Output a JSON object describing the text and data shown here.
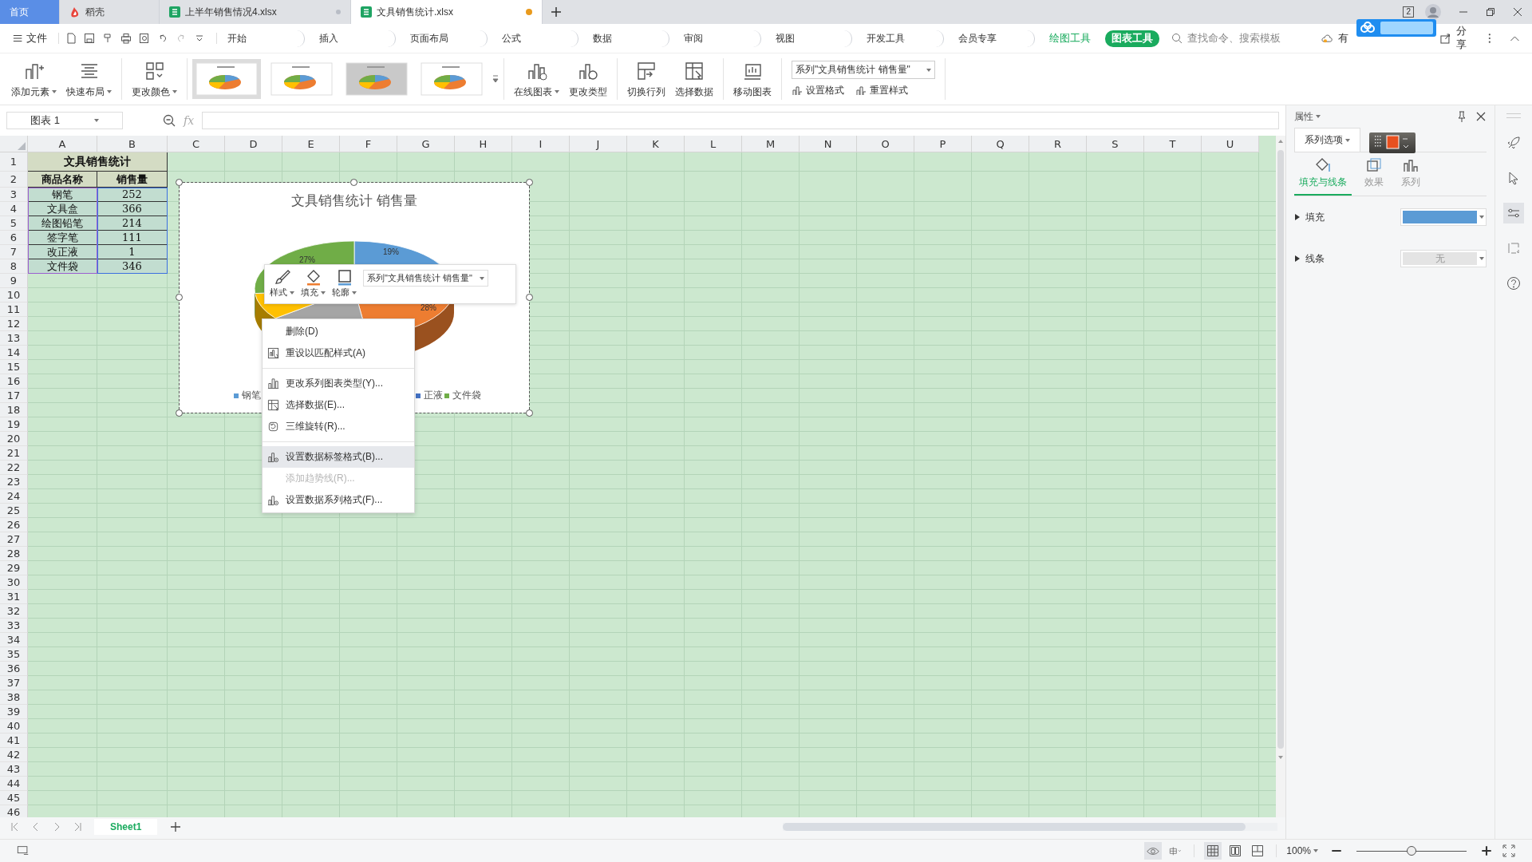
{
  "tabs": [
    {
      "label": "首页",
      "kind": "home",
      "selected": false
    },
    {
      "label": "稻壳",
      "kind": "docer",
      "selected": false
    },
    {
      "label": "上半年销售情况4.xlsx",
      "kind": "sheet",
      "selected": false,
      "modified": false
    },
    {
      "label": "文具销售统计.xlsx",
      "kind": "sheet",
      "selected": true,
      "modified": true
    }
  ],
  "title_bar": {
    "window_count": "2"
  },
  "menu": {
    "file": "文件",
    "items": [
      {
        "label": "开始",
        "kind": "tab",
        "selected": false
      },
      {
        "label": "插入",
        "kind": "tab",
        "selected": false
      },
      {
        "label": "页面布局",
        "kind": "tab",
        "selected": false
      },
      {
        "label": "公式",
        "kind": "tab",
        "selected": false
      },
      {
        "label": "数据",
        "kind": "tab",
        "selected": false
      },
      {
        "label": "审阅",
        "kind": "tab",
        "selected": false
      },
      {
        "label": "视图",
        "kind": "tab",
        "selected": false
      },
      {
        "label": "开发工具",
        "kind": "tab",
        "selected": false
      },
      {
        "label": "会员专享",
        "kind": "tab",
        "selected": false
      },
      {
        "label": "绘图工具",
        "kind": "context",
        "selected": false
      },
      {
        "label": "图表工具",
        "kind": "context",
        "selected": true
      }
    ],
    "search": {
      "placeholder": "查找命令、搜索模板"
    },
    "cloud_label": "有",
    "share": "分享"
  },
  "ribbon": {
    "left_buttons": [
      {
        "label": "添加元素",
        "dropdown": true
      },
      {
        "label": "快速布局",
        "dropdown": true
      },
      {
        "label": "更改颜色",
        "dropdown": true
      }
    ],
    "styles": [
      {
        "selected": true
      },
      {
        "selected": false
      },
      {
        "selected": false
      },
      {
        "selected": false
      }
    ],
    "right_buttons": [
      {
        "label": "在线图表",
        "dropdown": true
      },
      {
        "label": "更改类型",
        "dropdown": false
      },
      {
        "label": "切换行列",
        "dropdown": false
      },
      {
        "label": "选择数据",
        "dropdown": false
      },
      {
        "label": "移动图表",
        "dropdown": false
      }
    ],
    "series_select": "系列\"文具销售统计 销售量\"",
    "small_buttons": [
      "设置格式",
      "重置样式"
    ]
  },
  "formula_bar": {
    "name_box": "图表 1",
    "fx": "fx"
  },
  "sheet": {
    "columns": [
      "A",
      "B",
      "C",
      "D",
      "E",
      "F",
      "G",
      "H",
      "I",
      "J",
      "K",
      "L",
      "M",
      "N",
      "O",
      "P",
      "Q",
      "R",
      "S",
      "T",
      "U"
    ],
    "rows": [
      "1",
      "2",
      "3",
      "4",
      "5",
      "6",
      "7",
      "8",
      "9",
      "10",
      "11",
      "12",
      "13",
      "14",
      "15",
      "16",
      "17",
      "18",
      "19",
      "20",
      "21",
      "22",
      "23",
      "24",
      "25",
      "26",
      "27",
      "28",
      "29",
      "30",
      "31",
      "32",
      "33",
      "34",
      "35",
      "36",
      "37",
      "38",
      "39",
      "40",
      "41",
      "42",
      "43",
      "44",
      "45",
      "46"
    ],
    "table": {
      "title": "文具销售统计",
      "header": [
        "商品名称",
        "销售量"
      ],
      "rows": [
        [
          "钢笔",
          "252"
        ],
        [
          "文具盒",
          "366"
        ],
        [
          "绘图铅笔",
          "214"
        ],
        [
          "签字笔",
          "111"
        ],
        [
          "改正液",
          "1"
        ],
        [
          "文件袋",
          "346"
        ]
      ]
    },
    "tabs": [
      {
        "label": "Sheet1",
        "selected": true
      }
    ]
  },
  "chart": {
    "title": "文具销售统计 销售量",
    "slices": [
      {
        "color": "#5b9bd5"
      },
      {
        "color": "#ed7d31"
      },
      {
        "color": "#a5a5a5"
      },
      {
        "color": "#ffc000"
      },
      {
        "color": "#70ad47"
      }
    ],
    "data_labels": [
      "19%",
      "28%",
      "27%"
    ],
    "legend": [
      {
        "label": "钢笔",
        "color": "#5b9bd5"
      },
      {
        "label": "正液",
        "color": "#4472c4"
      },
      {
        "label": "文件袋",
        "color": "#70ad47"
      }
    ]
  },
  "mini_toolbar": {
    "buttons": [
      {
        "label": "样式",
        "kind": "brush"
      },
      {
        "label": "填充",
        "kind": "fill"
      },
      {
        "label": "轮廓",
        "kind": "outline"
      }
    ],
    "series_select": "系列\"文具销售统计 销售量\""
  },
  "context_menu": [
    {
      "kind": "plain",
      "label": "删除(D)",
      "disabled": false,
      "selected": false
    },
    {
      "kind": "reset",
      "label": "重设以匹配样式(A)",
      "disabled": false,
      "selected": false
    },
    {
      "kind": "separator"
    },
    {
      "kind": "chart",
      "label": "更改系列图表类型(Y)...",
      "disabled": false,
      "selected": false
    },
    {
      "kind": "data",
      "label": "选择数据(E)...",
      "disabled": false,
      "selected": false
    },
    {
      "kind": "rotate",
      "label": "三维旋转(R)...",
      "disabled": false,
      "selected": false
    },
    {
      "kind": "separator"
    },
    {
      "kind": "format",
      "label": "设置数据标签格式(B)...",
      "disabled": false,
      "selected": true
    },
    {
      "kind": "plain",
      "label": "添加趋势线(R)...",
      "disabled": true,
      "selected": false
    },
    {
      "kind": "format",
      "label": "设置数据系列格式(F)...",
      "disabled": false,
      "selected": false
    }
  ],
  "panel": {
    "title": "属性",
    "tab": "系列选项",
    "subtabs": [
      {
        "label": "填充与线条",
        "selected": true
      },
      {
        "label": "效果",
        "selected": false
      },
      {
        "label": "系列",
        "selected": false
      }
    ],
    "fill": {
      "label": "填充",
      "expanded": false,
      "color": "#5b9bd5"
    },
    "line": {
      "label": "线条",
      "expanded": false,
      "value": "无"
    }
  },
  "status": {
    "zoom": "100%",
    "zoom_slider": {
      "level": 0.5
    }
  }
}
